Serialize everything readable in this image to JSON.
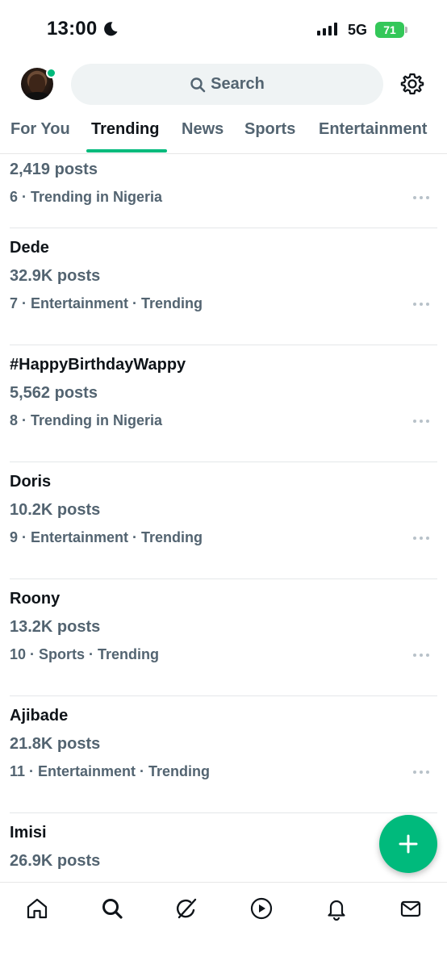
{
  "status_bar": {
    "time": "13:00",
    "network": "5G",
    "battery": "71",
    "icons": [
      "moon-icon",
      "signal-icon",
      "battery-icon"
    ]
  },
  "header": {
    "search_placeholder": "Search",
    "icons": [
      "avatar",
      "search-icon",
      "settings-icon"
    ],
    "accent_color": "#00ba7c"
  },
  "tabs": [
    {
      "label": "For You",
      "active": false
    },
    {
      "label": "Trending",
      "active": true
    },
    {
      "label": "News",
      "active": false
    },
    {
      "label": "Sports",
      "active": false
    },
    {
      "label": "Entertainment",
      "active": false
    }
  ],
  "trends": [
    {
      "topic": "",
      "posts": "2,419 posts",
      "meta": "6 · Trending in Nigeria"
    },
    {
      "topic": "Dede",
      "posts": "32.9K posts",
      "meta": "7 · Entertainment · Trending"
    },
    {
      "topic": "#HappyBirthdayWappy",
      "posts": "5,562 posts",
      "meta": "8 · Trending in Nigeria"
    },
    {
      "topic": "Doris",
      "posts": "10.2K posts",
      "meta": "9 · Entertainment · Trending"
    },
    {
      "topic": "Roony",
      "posts": "13.2K posts",
      "meta": "10 · Sports · Trending"
    },
    {
      "topic": "Ajibade",
      "posts": "21.8K posts",
      "meta": "11 · Entertainment · Trending"
    },
    {
      "topic": "Imisi",
      "posts": "26.9K posts",
      "meta": ""
    }
  ],
  "bottom_nav": [
    "home-icon",
    "search-icon",
    "grok-icon",
    "video-icon",
    "notifications-icon",
    "messages-icon"
  ],
  "fab_icon": "plus-icon"
}
